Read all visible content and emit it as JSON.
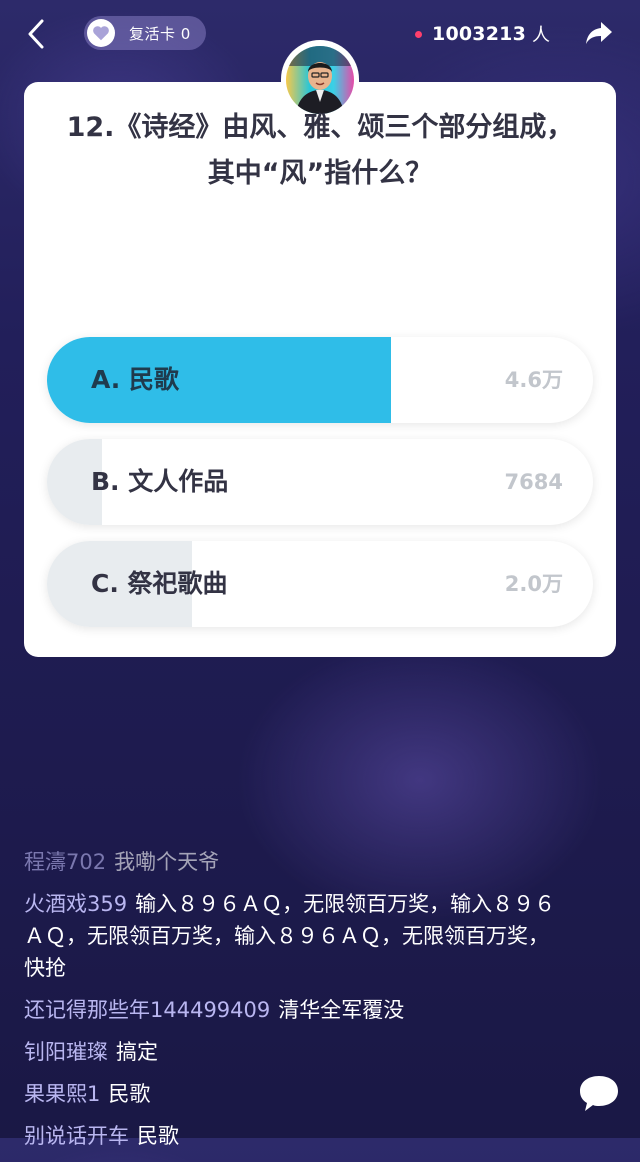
{
  "header": {
    "revive_card": "复活卡 0",
    "viewer_count": "1003213",
    "viewer_unit": "人"
  },
  "question": {
    "text": "12.《诗经》由风、雅、颂三个部分组成，其中“风”指什么？"
  },
  "options": [
    {
      "label": "A. 民歌",
      "count": "4.6万",
      "fraction": 0.63,
      "correct": true
    },
    {
      "label": "B. 文人作品",
      "count": "7684",
      "fraction": 0.1,
      "correct": false
    },
    {
      "label": "C. 祭祀歌曲",
      "count": "2.0万",
      "fraction": 0.265,
      "correct": false
    }
  ],
  "comments": [
    {
      "user": "程濤702",
      "text": "我嘞个天爷"
    },
    {
      "user": "火酒戏359",
      "text": "输入８９６ＡＱ，无限领百万奖，输入８９６ＡＱ，无限领百万奖，输入８９６ＡＱ，无限领百万奖，快抢"
    },
    {
      "user": "还记得那些年144499409",
      "text": "清华全军覆没"
    },
    {
      "user": "钊阳璀璨",
      "text": "搞定"
    },
    {
      "user": "果果熙1",
      "text": "民歌"
    },
    {
      "user": "别说话开车",
      "text": "民歌"
    }
  ],
  "colors": {
    "correct_fill": "#2fbde8",
    "other_fill": "#e8ecef",
    "username": "#b9b6f0"
  }
}
